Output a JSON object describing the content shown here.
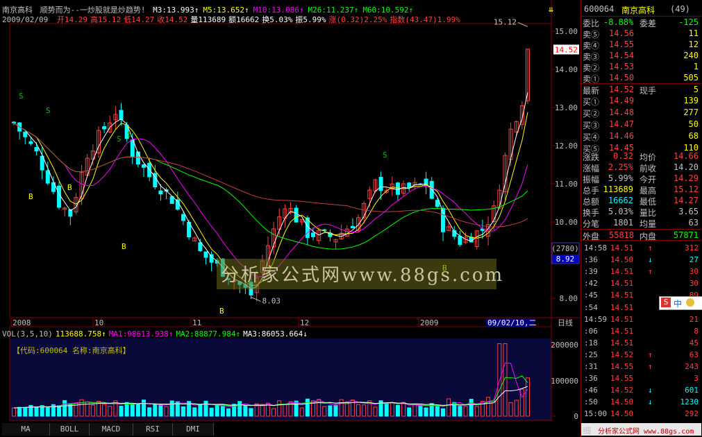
{
  "header": {
    "title_name": "南京高科",
    "title_tip": "顺势而为--一炒股就是炒趋势!",
    "ma_labels": [
      {
        "text": "M3:13.993",
        "color": "#ffffff"
      },
      {
        "text": "M5:13.652",
        "color": "#ffff00"
      },
      {
        "text": "M10:13.086",
        "color": "#ff00ff"
      },
      {
        "text": "M26:11.237",
        "color": "#00ff00"
      },
      {
        "text": "M60:10.592",
        "color": "#00ff00"
      }
    ],
    "date": "2009/02/09",
    "stats": [
      {
        "text": "开14.29",
        "color": "#ff4040"
      },
      {
        "text": "高15.12",
        "color": "#ff4040"
      },
      {
        "text": "低14.27",
        "color": "#ff4040"
      },
      {
        "text": "收14.52",
        "color": "#ff4040"
      },
      {
        "text": "量113689",
        "color": "#ffffff"
      },
      {
        "text": "额16662",
        "color": "#ffffff"
      },
      {
        "text": "换5.03%",
        "color": "#ffffff"
      },
      {
        "text": "振5.99%",
        "color": "#ffffff"
      },
      {
        "text": "涨(0.32)2.25%",
        "color": "#ff4040"
      },
      {
        "text": "指数(43.47)1.99%",
        "color": "#ff4040"
      }
    ]
  },
  "price_axis": {
    "ticks": [
      "15.00",
      "14.00",
      "13.00",
      "12.00",
      "11.00",
      "10.00",
      "9.00",
      "8.00"
    ],
    "current_price_tag": "14.52",
    "crosshair_tag_top": "(2780)",
    "crosshair_tag_bottom": "8.92"
  },
  "price_annotations": {
    "high": "15.12",
    "low": "8.03"
  },
  "signals": {
    "s": "S",
    "b": "B"
  },
  "date_axis": {
    "labels": [
      "2008",
      "10",
      "11",
      "12",
      "2009"
    ],
    "selected_date": "09/02/10,二",
    "period": "日线"
  },
  "volume": {
    "legend": [
      {
        "text": "VOL(3,5,10)",
        "color": "#c0c0c0"
      },
      {
        "text": "113688.758↑",
        "color": "#ffff00"
      },
      {
        "text": "MA1:98613.938↑",
        "color": "#ff00ff"
      },
      {
        "text": "MA2:88877.984↑",
        "color": "#00ff00"
      },
      {
        "text": "MA3:86053.664↓",
        "color": "#ffffff"
      }
    ],
    "code_label": "【代码:600064 名称:南京高科】",
    "axis_ticks": [
      "200000",
      "100000",
      "0"
    ]
  },
  "watermark": "分析家公式网www.88gs.com",
  "tabs": [
    "MA",
    "BOLL",
    "MACD",
    "RSI",
    "DMI"
  ],
  "quote": {
    "code": "600064",
    "name": "南京高科",
    "count": "(49)",
    "weibi_label": "委比",
    "weibi_value": "-8.88%",
    "weicha_label": "委差",
    "weicha_value": "-125",
    "sells": [
      {
        "label": "卖⑤",
        "price": "14.56",
        "vol": "11"
      },
      {
        "label": "卖④",
        "price": "14.55",
        "vol": "12"
      },
      {
        "label": "卖③",
        "price": "14.54",
        "vol": "240"
      },
      {
        "label": "卖②",
        "price": "14.53",
        "vol": "1"
      },
      {
        "label": "卖①",
        "price": "14.50",
        "vol": "505"
      }
    ],
    "latest_label": "最新",
    "latest_price": "14.52",
    "xianshou_label": "现手",
    "xianshou_value": "5",
    "buys": [
      {
        "label": "买①",
        "price": "14.49",
        "vol": "139"
      },
      {
        "label": "买②",
        "price": "14.48",
        "vol": "277"
      },
      {
        "label": "买③",
        "price": "14.47",
        "vol": "50"
      },
      {
        "label": "买④",
        "price": "14.46",
        "vol": "68"
      },
      {
        "label": "买⑤",
        "price": "14.45",
        "vol": "110"
      }
    ],
    "stats": [
      {
        "l1": "涨跌",
        "v1": "0.32",
        "l2": "均价",
        "v2": "14.66"
      },
      {
        "l1": "涨幅",
        "v1": "2.25%",
        "l2": "前收",
        "v2": "14.20"
      },
      {
        "l1": "振幅",
        "v1": "5.99%",
        "l2": "今开",
        "v2": "14.29"
      },
      {
        "l1": "总手",
        "v1": "113689",
        "l2": "最高",
        "v2": "15.12"
      },
      {
        "l1": "总额",
        "v1": "16662",
        "l2": "最低",
        "v2": "14.27"
      },
      {
        "l1": "换手",
        "v1": "5.03%",
        "l2": "量比",
        "v2": "3.65"
      },
      {
        "l1": "分笔",
        "v1": "1801",
        "l2": "均量",
        "v2": "63"
      }
    ],
    "waipan_label": "外盘",
    "waipan_value": "55818",
    "neipan_label": "内盘",
    "neipan_value": "57871",
    "ticks": [
      {
        "time": "14:58",
        "price": "14.51",
        "arrow": "↑",
        "vol": "312"
      },
      {
        "time": ":36",
        "price": "14.50",
        "arrow": "↓",
        "vol": "27"
      },
      {
        "time": ":39",
        "price": "14.51",
        "arrow": "↑",
        "vol": "30"
      },
      {
        "time": ":42",
        "price": "14.51",
        "arrow": "",
        "vol": "30"
      },
      {
        "time": ":45",
        "price": "14.51",
        "arrow": "",
        "vol": "89"
      },
      {
        "time": ":54",
        "price": "14.51",
        "arrow": "",
        "vol": "18"
      },
      {
        "time": "14:59",
        "price": "14.51",
        "arrow": "",
        "vol": "21"
      },
      {
        "time": ":06",
        "price": "14.51",
        "arrow": "",
        "vol": "8"
      },
      {
        "time": ":18",
        "price": "14.51",
        "arrow": "",
        "vol": "45"
      },
      {
        "time": ":25",
        "price": "14.52",
        "arrow": "↑",
        "vol": "63"
      },
      {
        "time": ":31",
        "price": "14.55",
        "arrow": "↑",
        "vol": "243"
      },
      {
        "time": ":36",
        "price": "14.55",
        "arrow": "",
        "vol": "3"
      },
      {
        "time": ":46",
        "price": "14.52",
        "arrow": "↓",
        "vol": "601"
      },
      {
        "time": ":50",
        "price": "14.50",
        "arrow": "↓",
        "vol": "1230"
      },
      {
        "time": "15:00",
        "price": "14.50",
        "arrow": "",
        "vol": "292"
      },
      {
        "time": ":04",
        "price": "14.50",
        "arrow": "",
        "vol": "5"
      }
    ],
    "footer_left": "细",
    "footer_right": "分析家公式网 www.88gs.com",
    "ime_label": "中"
  },
  "colors": {
    "up": "#ff4040",
    "down": "#00ffff",
    "axis": "#800000",
    "label_gray": "#c0c0c0",
    "ma_white": "#ffffff",
    "ma_yellow": "#ffff00",
    "ma_magenta": "#ff00ff",
    "ma_green": "#00ff00"
  }
}
